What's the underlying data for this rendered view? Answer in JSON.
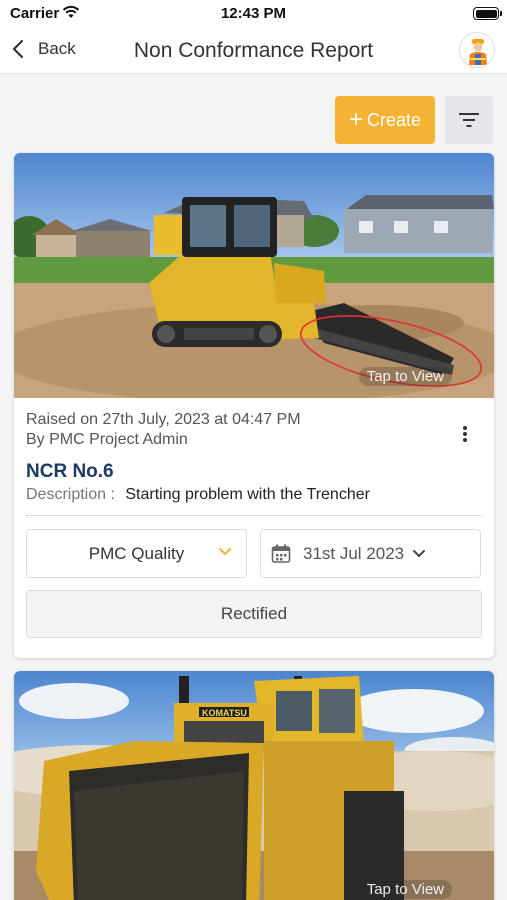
{
  "status_bar": {
    "carrier": "Carrier",
    "time": "12:43 PM"
  },
  "nav": {
    "back_label": "Back",
    "title": "Non Conformance Report"
  },
  "toolbar": {
    "create_label": "Create",
    "create_color": "#f5b335"
  },
  "cards": [
    {
      "tap_label": "Tap to View",
      "raised_line": "Raised on 27th July, 2023 at 04:47 PM",
      "by_line": "By PMC Project Admin",
      "ncr_no": "NCR No.6",
      "description_label": "Description :",
      "description": "Starting problem with the Trencher",
      "department": "PMC Quality",
      "date": "31st Jul 2023",
      "status": "Rectified"
    },
    {
      "tap_label": "Tap to View"
    }
  ],
  "colors": {
    "accent": "#f5b335",
    "title_blue": "#1d3a66"
  }
}
